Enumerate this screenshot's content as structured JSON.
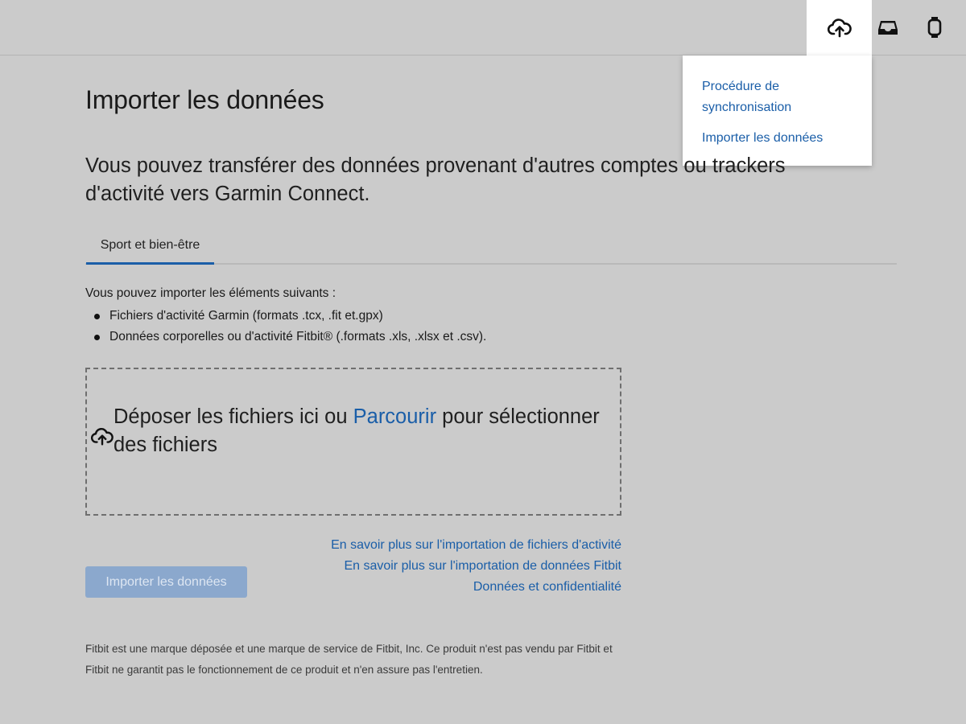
{
  "header": {
    "icons": [
      {
        "name": "upload-cloud-icon",
        "active": true
      },
      {
        "name": "inbox-icon",
        "active": false
      },
      {
        "name": "watch-icon",
        "active": false
      }
    ]
  },
  "dropdown": {
    "items": [
      {
        "label": "Procédure de synchronisation"
      },
      {
        "label": "Importer les données"
      }
    ]
  },
  "main": {
    "title": "Importer les données",
    "intro": "Vous pouvez transférer des données provenant d'autres comptes ou trackers d'activité vers Garmin Connect.",
    "tabs": [
      {
        "label": "Sport et bien-être",
        "active": true
      }
    ],
    "import_intro": "Vous pouvez importer les éléments suivants :",
    "formats": [
      "Fichiers d'activité Garmin (formats .tcx, .fit et.gpx)",
      "Données corporelles ou d'activité Fitbit® (.formats .xls, .xlsx et .csv)."
    ],
    "dropzone": {
      "text_before": "Déposer les fichiers ici ou ",
      "browse_label": "Parcourir",
      "text_after": " pour sélectionner des fichiers"
    },
    "links": [
      "En savoir plus sur l'importation de fichiers d'activité",
      "En savoir plus sur l'importation de données Fitbit",
      "Données et confidentialité"
    ],
    "import_button": "Importer les données",
    "disclaimer": "Fitbit est une marque déposée et une marque de service de Fitbit, Inc. Ce produit n'est pas vendu par Fitbit et Fitbit ne garantit pas le fonctionnement de ce produit et n'en assure pas l'entretien."
  },
  "colors": {
    "background": "#cbcbcb",
    "link": "#1a5ea8",
    "button_disabled": "#8ba8cd"
  }
}
